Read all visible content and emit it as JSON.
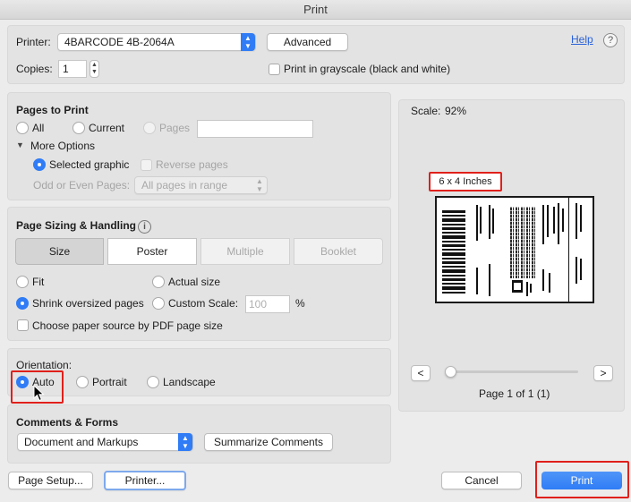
{
  "window": {
    "title": "Print"
  },
  "top": {
    "printer_label": "Printer:",
    "printer_value": "4BARCODE 4B-2064A",
    "advanced_label": "Advanced",
    "help_label": "Help",
    "help_icon": "?",
    "copies_label": "Copies:",
    "copies_value": "1",
    "grayscale_label": "Print in grayscale (black and white)"
  },
  "pages_to_print": {
    "title": "Pages to Print",
    "all_label": "All",
    "current_label": "Current",
    "pages_label": "Pages",
    "pages_value": "",
    "more_options_label": "More Options",
    "selected_graphic_label": "Selected graphic",
    "reverse_pages_label": "Reverse pages",
    "odd_even_label": "Odd or Even Pages:",
    "odd_even_value": "All pages in range"
  },
  "sizing": {
    "title": "Page Sizing & Handling",
    "info_icon": "i",
    "tabs": [
      "Size",
      "Poster",
      "Multiple",
      "Booklet"
    ],
    "fit_label": "Fit",
    "actual_size_label": "Actual size",
    "shrink_label": "Shrink oversized pages",
    "custom_scale_label": "Custom Scale:",
    "custom_scale_placeholder": "100",
    "percent": "%",
    "paper_source_label": "Choose paper source by PDF page size"
  },
  "orientation": {
    "title": "Orientation:",
    "auto_label": "Auto",
    "portrait_label": "Portrait",
    "landscape_label": "Landscape"
  },
  "comments": {
    "title": "Comments & Forms",
    "value": "Document and Markups",
    "summarize_label": "Summarize Comments"
  },
  "preview": {
    "scale_label": "Scale:",
    "scale_value": "92%",
    "size_label": "6 x 4 Inches",
    "prev_label": "<",
    "next_label": ">",
    "page_info": "Page 1 of 1 (1)"
  },
  "footer": {
    "page_setup_label": "Page Setup...",
    "printer_label": "Printer...",
    "cancel_label": "Cancel",
    "print_label": "Print"
  },
  "colors": {
    "accent": "#2f7cf6",
    "highlight": "#e0201b"
  }
}
